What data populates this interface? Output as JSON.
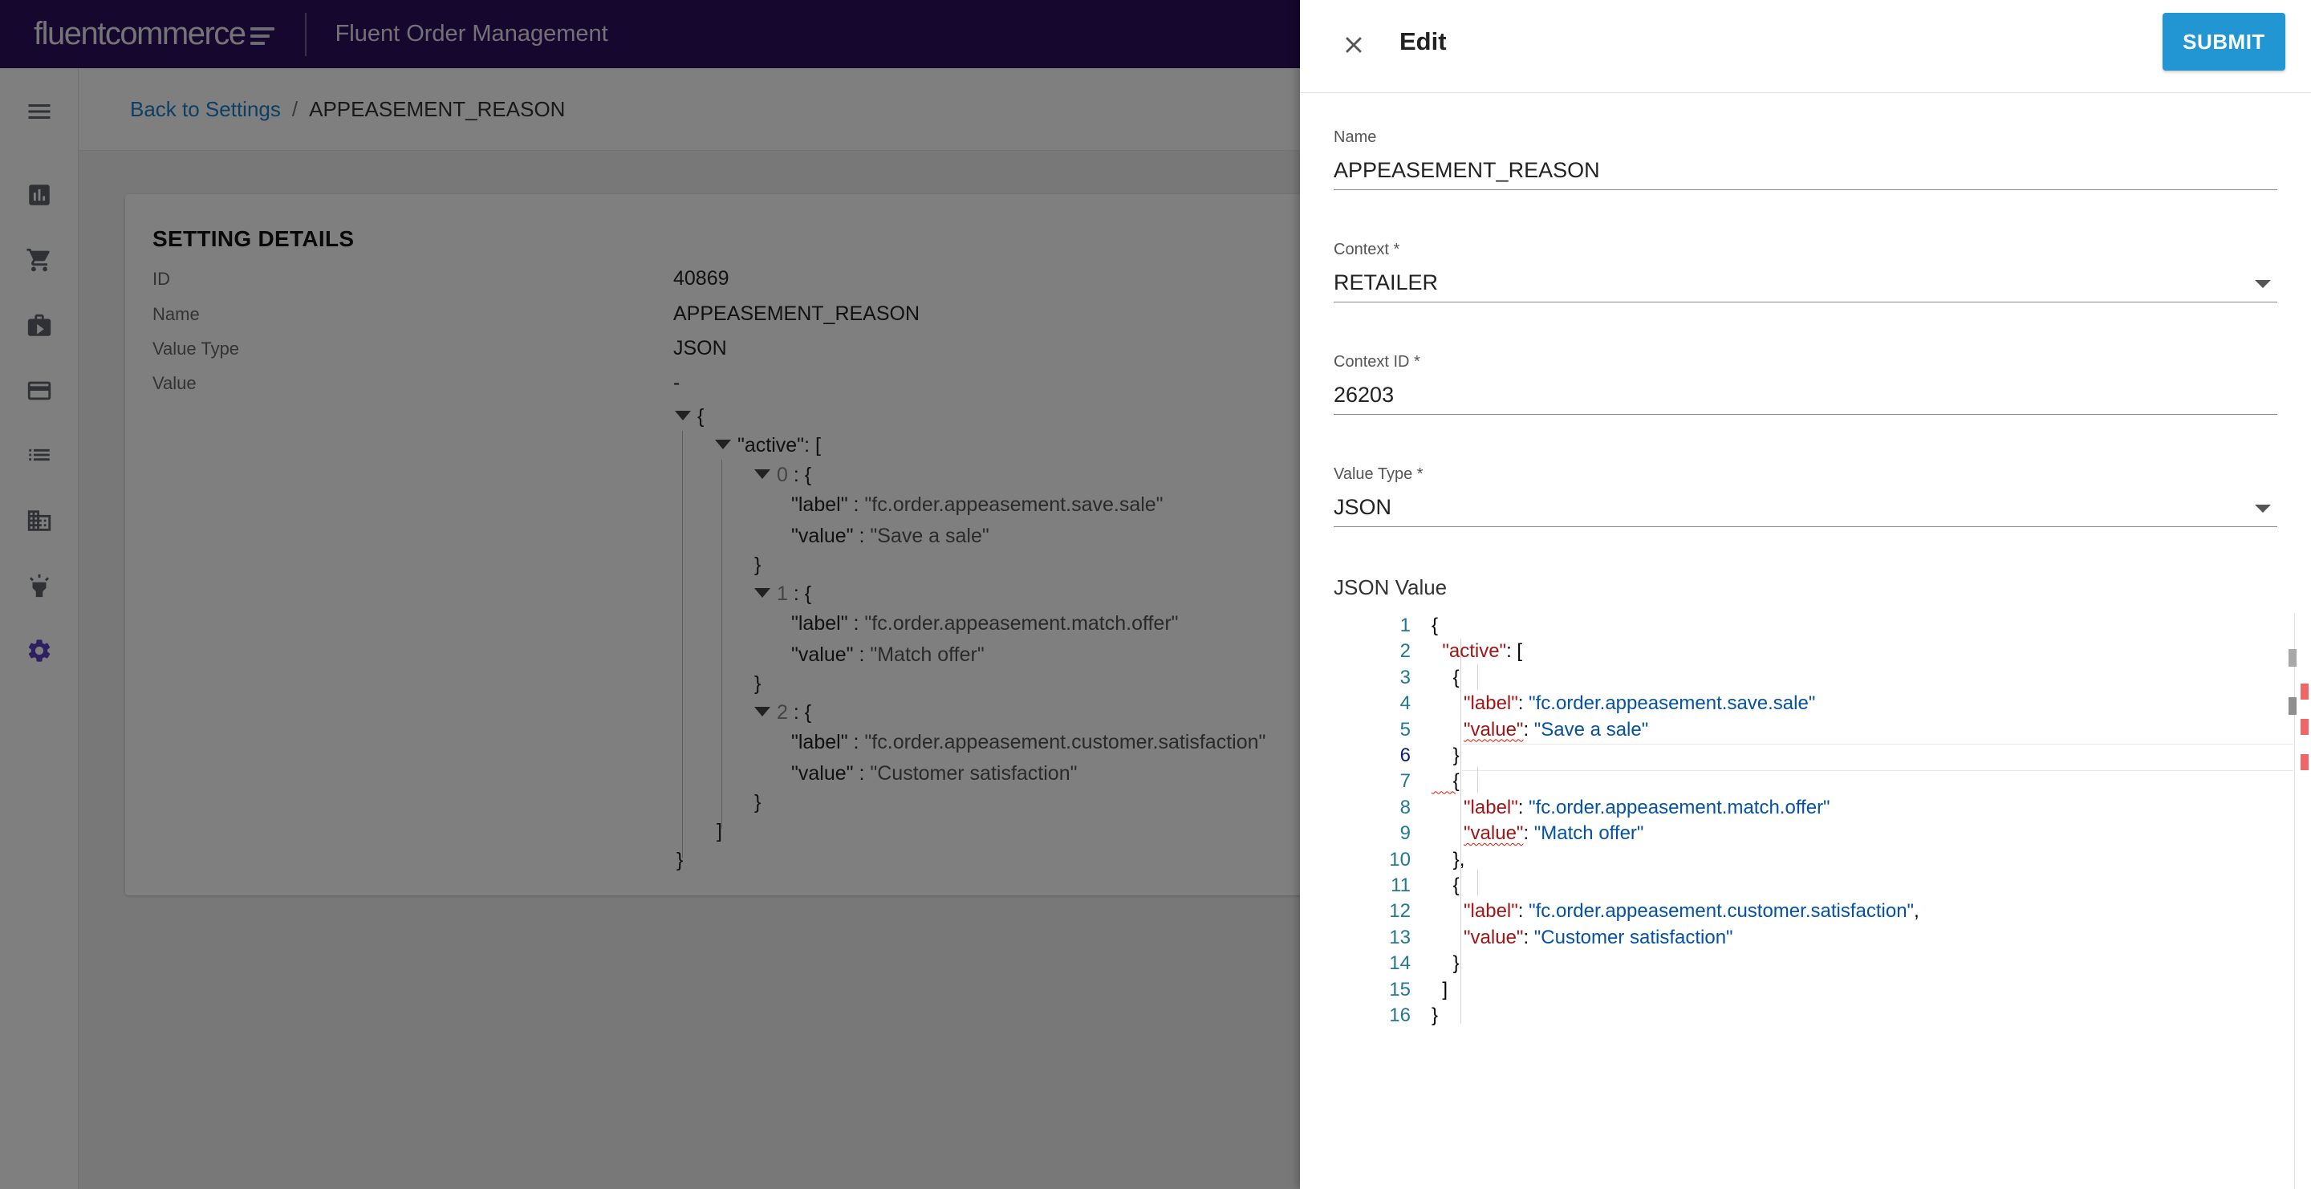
{
  "topbar": {
    "logo_text": "fluentcommerce",
    "app_title": "Fluent Order Management",
    "background": "#2b0f5a"
  },
  "nav": {
    "items": [
      {
        "icon": "menu-icon"
      },
      {
        "icon": "bar-chart-icon"
      },
      {
        "icon": "cart-icon"
      },
      {
        "icon": "video-icon"
      },
      {
        "icon": "card-icon"
      },
      {
        "icon": "list-icon"
      },
      {
        "icon": "building-icon"
      },
      {
        "icon": "lightbulb-icon"
      },
      {
        "icon": "settings-gear-icon",
        "active": true
      }
    ]
  },
  "breadcrumb": {
    "back_label": "Back to Settings",
    "separator": "/",
    "current": "APPEASEMENT_REASON"
  },
  "details": {
    "title": "SETTING DETAILS",
    "rows": [
      {
        "label": "ID",
        "value": "40869"
      },
      {
        "label": "Name",
        "value": "APPEASEMENT_REASON"
      },
      {
        "label": "Value Type",
        "value": "JSON"
      },
      {
        "label": "Value",
        "value": "-"
      }
    ],
    "tree": {
      "root_open": "{",
      "array_key": "\"active\"",
      "array_open": ": [",
      "items": [
        {
          "index": "0",
          "label": "\"fc.order.appeasement.save.sale\"",
          "value": "\"Save a sale\""
        },
        {
          "index": "1",
          "label": "\"fc.order.appeasement.match.offer\"",
          "value": "\"Match offer\""
        },
        {
          "index": "2",
          "label": "\"fc.order.appeasement.customer.satisfaction\"",
          "value": "\"Customer satisfaction\""
        }
      ],
      "label_key": "\"label\"",
      "value_key": "\"value\"",
      "colon": " : ",
      "obj_open": " : {",
      "obj_close": "}",
      "array_close": "]",
      "root_close": "}"
    }
  },
  "drawer": {
    "title": "Edit",
    "submit_label": "SUBMIT",
    "accent": "#2196d3",
    "fields": {
      "name": {
        "label": "Name",
        "value": "APPEASEMENT_REASON"
      },
      "context": {
        "label": "Context *",
        "value": "RETAILER"
      },
      "context_id": {
        "label": "Context ID *",
        "value": "26203"
      },
      "value_type": {
        "label": "Value Type *",
        "value": "JSON"
      }
    },
    "json_label": "JSON Value",
    "editor": {
      "current_line": 6,
      "lines": [
        {
          "n": "1",
          "tokens": [
            {
              "t": "{",
              "c": "p"
            }
          ]
        },
        {
          "n": "2",
          "tokens": [
            {
              "t": "  ",
              "c": "p"
            },
            {
              "t": "\"active\"",
              "c": "k"
            },
            {
              "t": ": [",
              "c": "p"
            }
          ]
        },
        {
          "n": "3",
          "tokens": [
            {
              "t": "    {",
              "c": "p"
            }
          ]
        },
        {
          "n": "4",
          "tokens": [
            {
              "t": "      ",
              "c": "p"
            },
            {
              "t": "\"label\"",
              "c": "k"
            },
            {
              "t": ": ",
              "c": "p"
            },
            {
              "t": "\"fc.order.appeasement.save.sale\"",
              "c": "s"
            }
          ]
        },
        {
          "n": "5",
          "tokens": [
            {
              "t": "      ",
              "c": "p"
            },
            {
              "t": "\"value\"",
              "c": "k",
              "err": true
            },
            {
              "t": ": ",
              "c": "p"
            },
            {
              "t": "\"Save a sale\"",
              "c": "s"
            }
          ]
        },
        {
          "n": "6",
          "tokens": [
            {
              "t": "    }",
              "c": "p"
            }
          ]
        },
        {
          "n": "7",
          "tokens": [
            {
              "t": "    {",
              "c": "p",
              "err": true
            }
          ]
        },
        {
          "n": "8",
          "tokens": [
            {
              "t": "      ",
              "c": "p"
            },
            {
              "t": "\"label\"",
              "c": "k"
            },
            {
              "t": ": ",
              "c": "p"
            },
            {
              "t": "\"fc.order.appeasement.match.offer\"",
              "c": "s"
            }
          ]
        },
        {
          "n": "9",
          "tokens": [
            {
              "t": "      ",
              "c": "p"
            },
            {
              "t": "\"value\"",
              "c": "k",
              "err": true
            },
            {
              "t": ": ",
              "c": "p"
            },
            {
              "t": "\"Match offer\"",
              "c": "s"
            }
          ]
        },
        {
          "n": "10",
          "tokens": [
            {
              "t": "    },",
              "c": "p"
            }
          ]
        },
        {
          "n": "11",
          "tokens": [
            {
              "t": "    {",
              "c": "p"
            }
          ]
        },
        {
          "n": "12",
          "tokens": [
            {
              "t": "      ",
              "c": "p"
            },
            {
              "t": "\"label\"",
              "c": "k"
            },
            {
              "t": ": ",
              "c": "p"
            },
            {
              "t": "\"fc.order.appeasement.customer.satisfaction\"",
              "c": "s"
            },
            {
              "t": ",",
              "c": "p"
            }
          ]
        },
        {
          "n": "13",
          "tokens": [
            {
              "t": "      ",
              "c": "p"
            },
            {
              "t": "\"value\"",
              "c": "k"
            },
            {
              "t": ": ",
              "c": "p"
            },
            {
              "t": "\"Customer satisfaction\"",
              "c": "s"
            }
          ]
        },
        {
          "n": "14",
          "tokens": [
            {
              "t": "    }",
              "c": "p"
            }
          ]
        },
        {
          "n": "15",
          "tokens": [
            {
              "t": "  ]",
              "c": "p"
            }
          ]
        },
        {
          "n": "16",
          "tokens": [
            {
              "t": "}",
              "c": "p"
            }
          ]
        }
      ]
    }
  }
}
